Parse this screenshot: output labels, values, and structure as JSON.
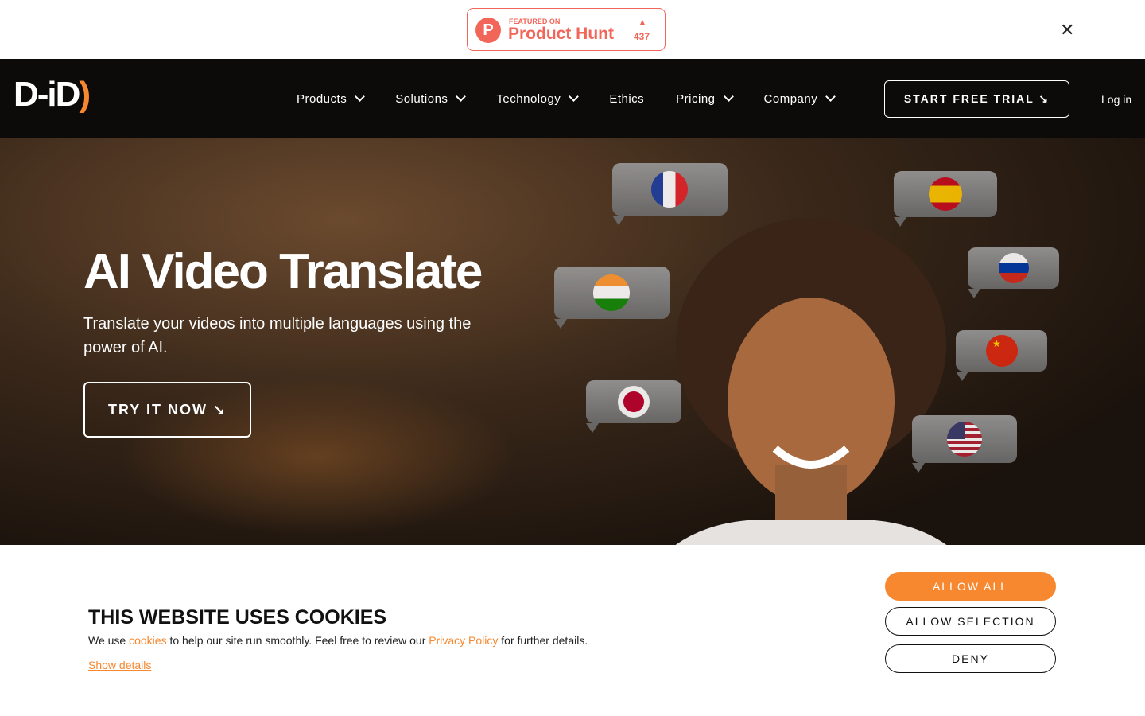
{
  "banner": {
    "featured": "FEATURED ON",
    "name": "Product Hunt",
    "votes": "437",
    "logo_letter": "P",
    "close_icon": "close-icon"
  },
  "nav": {
    "brand": "D-iD",
    "items": [
      {
        "label": "Products",
        "dropdown": true
      },
      {
        "label": "Solutions",
        "dropdown": true
      },
      {
        "label": "Technology",
        "dropdown": true
      },
      {
        "label": "Ethics",
        "dropdown": false
      },
      {
        "label": "Pricing",
        "dropdown": true
      },
      {
        "label": "Company",
        "dropdown": true
      }
    ],
    "trial": "START FREE TRIAL ↘",
    "login": "Log in"
  },
  "hero": {
    "title": "AI Video Translate",
    "subtitle": "Translate your videos into multiple languages using the power of AI.",
    "cta": "TRY IT NOW ↘",
    "flags": [
      "france",
      "spain",
      "india",
      "russia",
      "china",
      "japan",
      "usa"
    ]
  },
  "cookies": {
    "title": "THIS WEBSITE USES COOKIES",
    "text_before": "We use ",
    "link1": "cookies",
    "text_mid": " to help our site run smoothly. Feel free to review our ",
    "link2": "Privacy Policy",
    "text_after": " for further details.",
    "show_details": "Show details",
    "allow_all": "ALLOW ALL",
    "allow_selection": "ALLOW SELECTION",
    "deny": "DENY"
  },
  "colors": {
    "accent": "#f7882f",
    "producthunt": "#f2665a",
    "nav_bg": "#0d0b09"
  }
}
